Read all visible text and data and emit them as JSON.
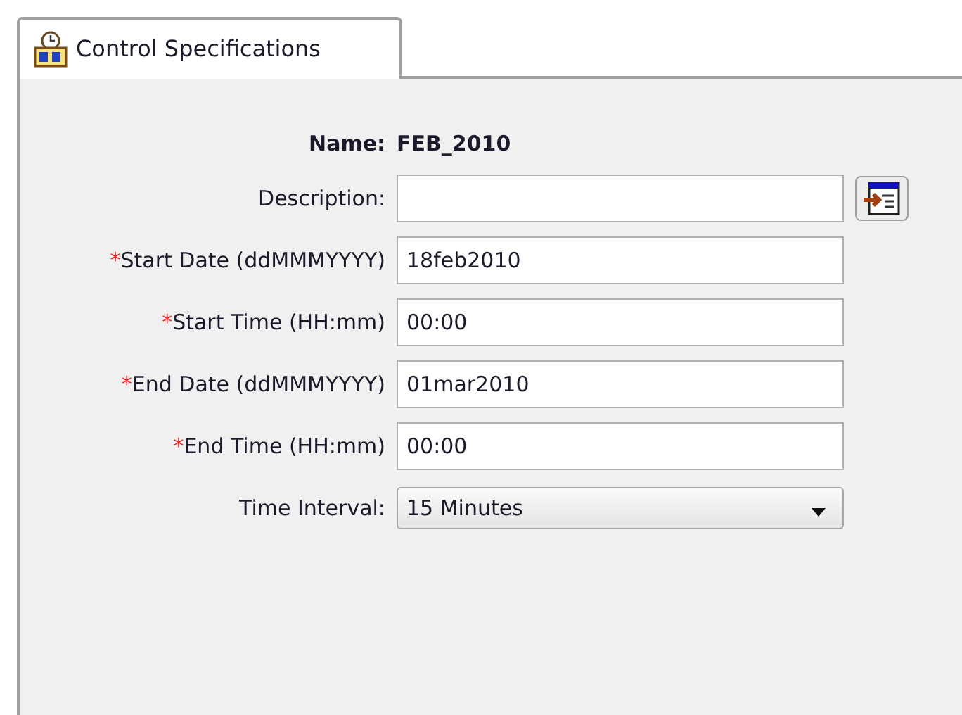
{
  "tabs": [
    {
      "label": "Control Specifications",
      "selected": true
    }
  ],
  "name": {
    "label": "Name:",
    "value": "FEB_2010"
  },
  "fields": [
    {
      "kind": "text",
      "label": "Description:",
      "button": true
    },
    {
      "kind": "text",
      "required_mark": "*",
      "label": "Start Date (ddMMMYYYY)",
      "value": "18feb2010"
    },
    {
      "kind": "text",
      "required_mark": "*",
      "label": "Start Time (HH:mm)",
      "value": "00:00"
    },
    {
      "kind": "text",
      "required_mark": "*",
      "label": "End Date (ddMMMYYYY)",
      "value": "01mar2010"
    },
    {
      "kind": "text",
      "required_mark": "*",
      "label": "End Time (HH:mm)",
      "value": "00:00"
    },
    {
      "kind": "select",
      "label": "Time Interval:",
      "value": "15 Minutes"
    }
  ]
}
